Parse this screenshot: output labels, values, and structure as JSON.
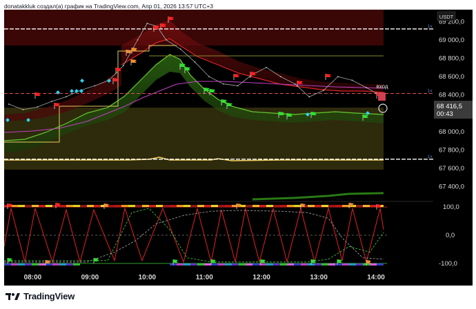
{
  "caption": "donatakkluk создал(а) график на TradingView.com, Апр 01, 2026 13:57 UTC+3",
  "currency": "USDT",
  "brand": "TradingView",
  "price_axis": {
    "ticks": [
      "69 200,0",
      "69 000,0",
      "68 800,0",
      "68 600,0",
      "68 400,0",
      "68 200,0",
      "68 000,0",
      "67 800,0",
      "67 600,0",
      "67 400,0"
    ],
    "line_tag": "1ч"
  },
  "last_price": {
    "value": "68 416,5",
    "countdown": "00:43"
  },
  "signal_label": "вход",
  "osc_axis": {
    "ticks": [
      "100,0",
      "0,0",
      "-100,0"
    ]
  },
  "time_axis": {
    "ticks": [
      "08:00",
      "09:00",
      "10:00",
      "11:00",
      "12:00",
      "13:00",
      "14:00"
    ]
  },
  "colors": {
    "background": "#000000",
    "bear_band": "#5a0a0a",
    "bull_band": "#1f4a10",
    "support_zone": "#3a3410",
    "red_line": "#e02020",
    "green_line": "#5fbf2a",
    "yellow_line": "#f0d060",
    "magenta_line": "#c040c0",
    "price_tag": "#3b3b3b"
  },
  "chart_data": {
    "type": "line",
    "ylim": [
      67300,
      69330
    ],
    "xlim": [
      "07:30",
      "15:00"
    ],
    "horizontal_levels": [
      69120,
      68416.5,
      67700
    ],
    "price_series": {
      "x": [
        "07:35",
        "07:50",
        "08:05",
        "08:20",
        "08:35",
        "08:50",
        "09:05",
        "09:20",
        "09:35",
        "09:50",
        "10:00",
        "10:10",
        "10:20",
        "10:35",
        "10:50",
        "11:05",
        "11:20",
        "11:35",
        "11:50",
        "12:05",
        "12:20",
        "12:35",
        "12:50",
        "13:05",
        "13:20",
        "13:35",
        "13:50",
        "14:00"
      ],
      "y": [
        68300,
        68240,
        68270,
        68330,
        68380,
        68450,
        68500,
        68560,
        68720,
        69000,
        69180,
        69150,
        69000,
        68900,
        68760,
        68600,
        68520,
        68500,
        68620,
        68700,
        68600,
        68520,
        68380,
        68450,
        68600,
        68560,
        68480,
        68420
      ]
    },
    "oscillator": {
      "ylim": [
        -110,
        110
      ],
      "ticks": [
        100,
        0,
        -100
      ]
    }
  }
}
